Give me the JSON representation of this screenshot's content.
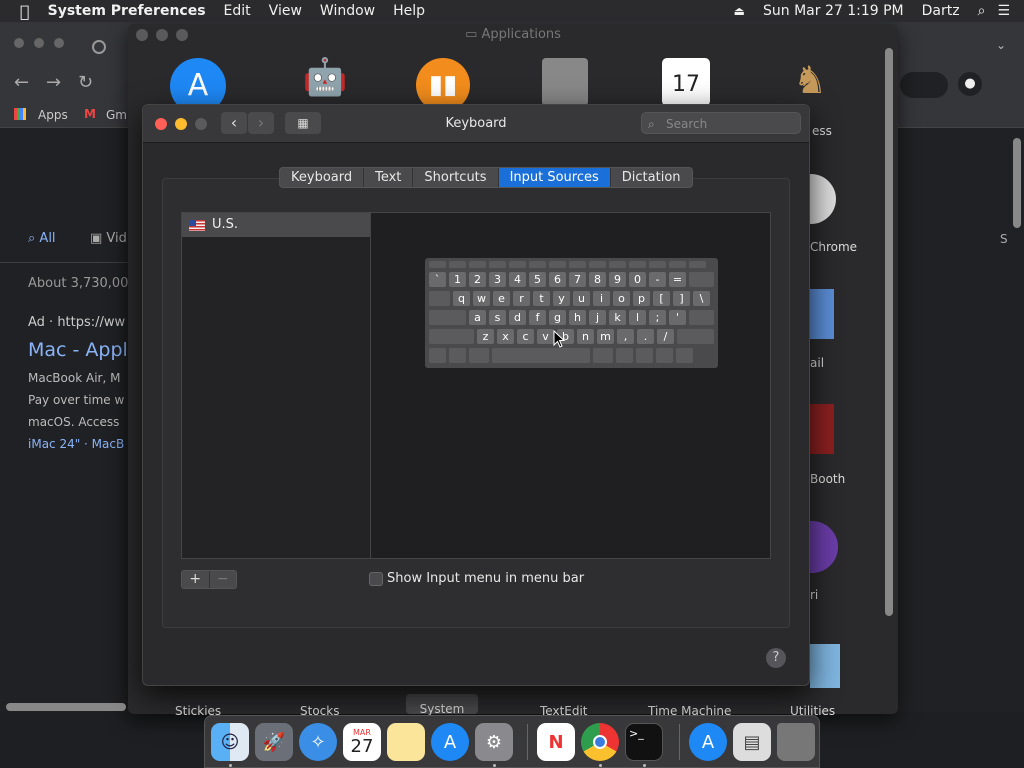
{
  "menubar": {
    "app_name": "System Preferences",
    "items": [
      "Edit",
      "View",
      "Window",
      "Help"
    ],
    "clock": "Sun Mar 27  1:19 PM",
    "user": "Dartz"
  },
  "chrome": {
    "bookmarks": [
      "Apps",
      "Gm"
    ],
    "search_tabs": [
      "All",
      "Vid"
    ],
    "result_count": "About 3,730,00",
    "ad_line": "Ad · https://ww",
    "ad_title": "Mac - Apple",
    "ad_lines": [
      "MacBook Air, M",
      "Pay over time w",
      "macOS. Access"
    ],
    "ad_links": "iMac 24\" · MacB"
  },
  "finder": {
    "title": "Applications",
    "side_labels": [
      "ess",
      "Chrome",
      "ail",
      "Booth",
      "ri",
      "Utilities"
    ],
    "bottom_labels": [
      "Stickies",
      "Stocks",
      "System",
      "TextEdit",
      "Time Machine"
    ]
  },
  "prefs": {
    "title": "Keyboard",
    "search_placeholder": "Search",
    "tabs": [
      "Keyboard",
      "Text",
      "Shortcuts",
      "Input Sources",
      "Dictation"
    ],
    "active_tab": "Input Sources",
    "sources": [
      "U.S."
    ],
    "add_label": "+",
    "remove_label": "−",
    "checkbox_label": "Show Input menu in menu bar",
    "help_label": "?"
  },
  "keyboard": {
    "row1": [
      "`",
      "1",
      "2",
      "3",
      "4",
      "5",
      "6",
      "7",
      "8",
      "9",
      "0",
      "-",
      "="
    ],
    "row2": [
      "q",
      "w",
      "e",
      "r",
      "t",
      "y",
      "u",
      "i",
      "o",
      "p",
      "[",
      "]",
      "\\"
    ],
    "row3": [
      "a",
      "s",
      "d",
      "f",
      "g",
      "h",
      "j",
      "k",
      "l",
      ";",
      "'"
    ],
    "row4": [
      "z",
      "x",
      "c",
      "v",
      "b",
      "n",
      "m",
      ",",
      ".",
      "/"
    ]
  },
  "dock": {
    "calendar_month": "MAR",
    "calendar_day": "27",
    "icons": [
      "finder-icon",
      "launchpad-icon",
      "safari-icon",
      "calendar-icon",
      "notes-icon",
      "app-store-icon",
      "system-preferences-icon",
      "news-icon",
      "chrome-icon",
      "terminal-icon",
      "app-store-icon",
      "file-icon",
      "trash-icon"
    ]
  }
}
